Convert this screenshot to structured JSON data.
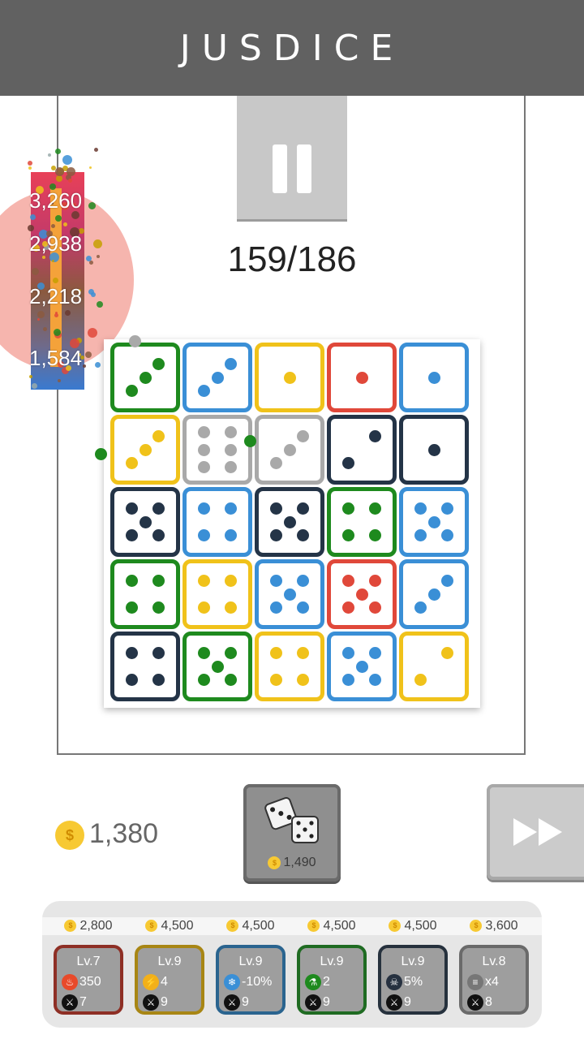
{
  "app": {
    "title": "JUSDICE"
  },
  "wave": {
    "text": "159/186"
  },
  "enemy": {
    "hp_values": [
      "3,260",
      "2,938",
      "2,218",
      "1,584"
    ]
  },
  "wallet": {
    "coins": "1,380"
  },
  "roll_button": {
    "cost": "1,490"
  },
  "colors": {
    "header": "#616161",
    "dice": {
      "green": "#1e8a1e",
      "blue": "#3a8fd6",
      "yellow": "#f0c21a",
      "red": "#e0483a",
      "navy": "#243447",
      "gray": "#a9a9a9"
    }
  },
  "board": {
    "rows": 5,
    "cols": 5,
    "dice": [
      {
        "color": "green",
        "pips": 3
      },
      {
        "color": "blue",
        "pips": 3
      },
      {
        "color": "yellow",
        "pips": 1
      },
      {
        "color": "red",
        "pips": 1
      },
      {
        "color": "blue",
        "pips": 1
      },
      {
        "color": "yellow",
        "pips": 3
      },
      {
        "color": "gray",
        "pips": 6
      },
      {
        "color": "gray",
        "pips": 3
      },
      {
        "color": "navy",
        "pips": 2
      },
      {
        "color": "navy",
        "pips": 1
      },
      {
        "color": "navy",
        "pips": 5
      },
      {
        "color": "blue",
        "pips": 4
      },
      {
        "color": "navy",
        "pips": 5
      },
      {
        "color": "green",
        "pips": 4
      },
      {
        "color": "blue",
        "pips": 5
      },
      {
        "color": "green",
        "pips": 4
      },
      {
        "color": "yellow",
        "pips": 4
      },
      {
        "color": "blue",
        "pips": 5
      },
      {
        "color": "red",
        "pips": 5
      },
      {
        "color": "blue",
        "pips": 3
      },
      {
        "color": "navy",
        "pips": 4
      },
      {
        "color": "green",
        "pips": 5
      },
      {
        "color": "yellow",
        "pips": 4
      },
      {
        "color": "blue",
        "pips": 5
      },
      {
        "color": "yellow",
        "pips": 2
      }
    ]
  },
  "upgrades": [
    {
      "price": "2,800",
      "level": "Lv.7",
      "stat": "350",
      "attack": "7",
      "color": "#8e2f25",
      "icon": "fire-icon"
    },
    {
      "price": "4,500",
      "level": "Lv.9",
      "stat": "4",
      "attack": "9",
      "color": "#a88614",
      "icon": "lightning-icon"
    },
    {
      "price": "4,500",
      "level": "Lv.9",
      "stat": "-10%",
      "attack": "9",
      "color": "#2a648f",
      "icon": "snowflake-icon"
    },
    {
      "price": "4,500",
      "level": "Lv.9",
      "stat": "2",
      "attack": "9",
      "color": "#1f6b22",
      "icon": "poison-icon"
    },
    {
      "price": "4,500",
      "level": "Lv.9",
      "stat": "5%",
      "attack": "9",
      "color": "#26313d",
      "icon": "skull-icon"
    },
    {
      "price": "3,600",
      "level": "Lv.8",
      "stat": "x4",
      "attack": "8",
      "color": "#6a6a6a",
      "icon": "wind-icon"
    }
  ]
}
